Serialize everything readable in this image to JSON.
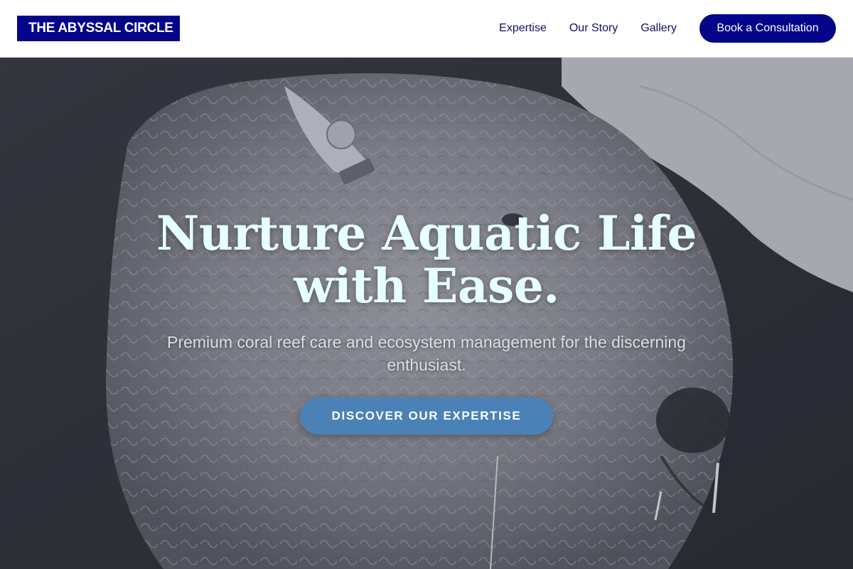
{
  "header": {
    "logo_text": "THE ABYSSAL CIRCLE",
    "nav": [
      {
        "label": "Expertise"
      },
      {
        "label": "Our Story"
      },
      {
        "label": "Gallery"
      }
    ],
    "cta_label": "Book a Consultation"
  },
  "hero": {
    "title": "Nurture Aquatic Life with Ease.",
    "subtitle": "Premium coral reef care and ecosystem management for the discerning enthusiast.",
    "button_label": "DISCOVER OUR EXPERTISE",
    "image_subject": "close-up grayscale photo of a curly-fleeced sheep with ear tags"
  },
  "colors": {
    "brand": "#05058a",
    "hero_title": "#e6ffff",
    "hero_button": "#4a82b8",
    "nav_text": "#101060"
  }
}
